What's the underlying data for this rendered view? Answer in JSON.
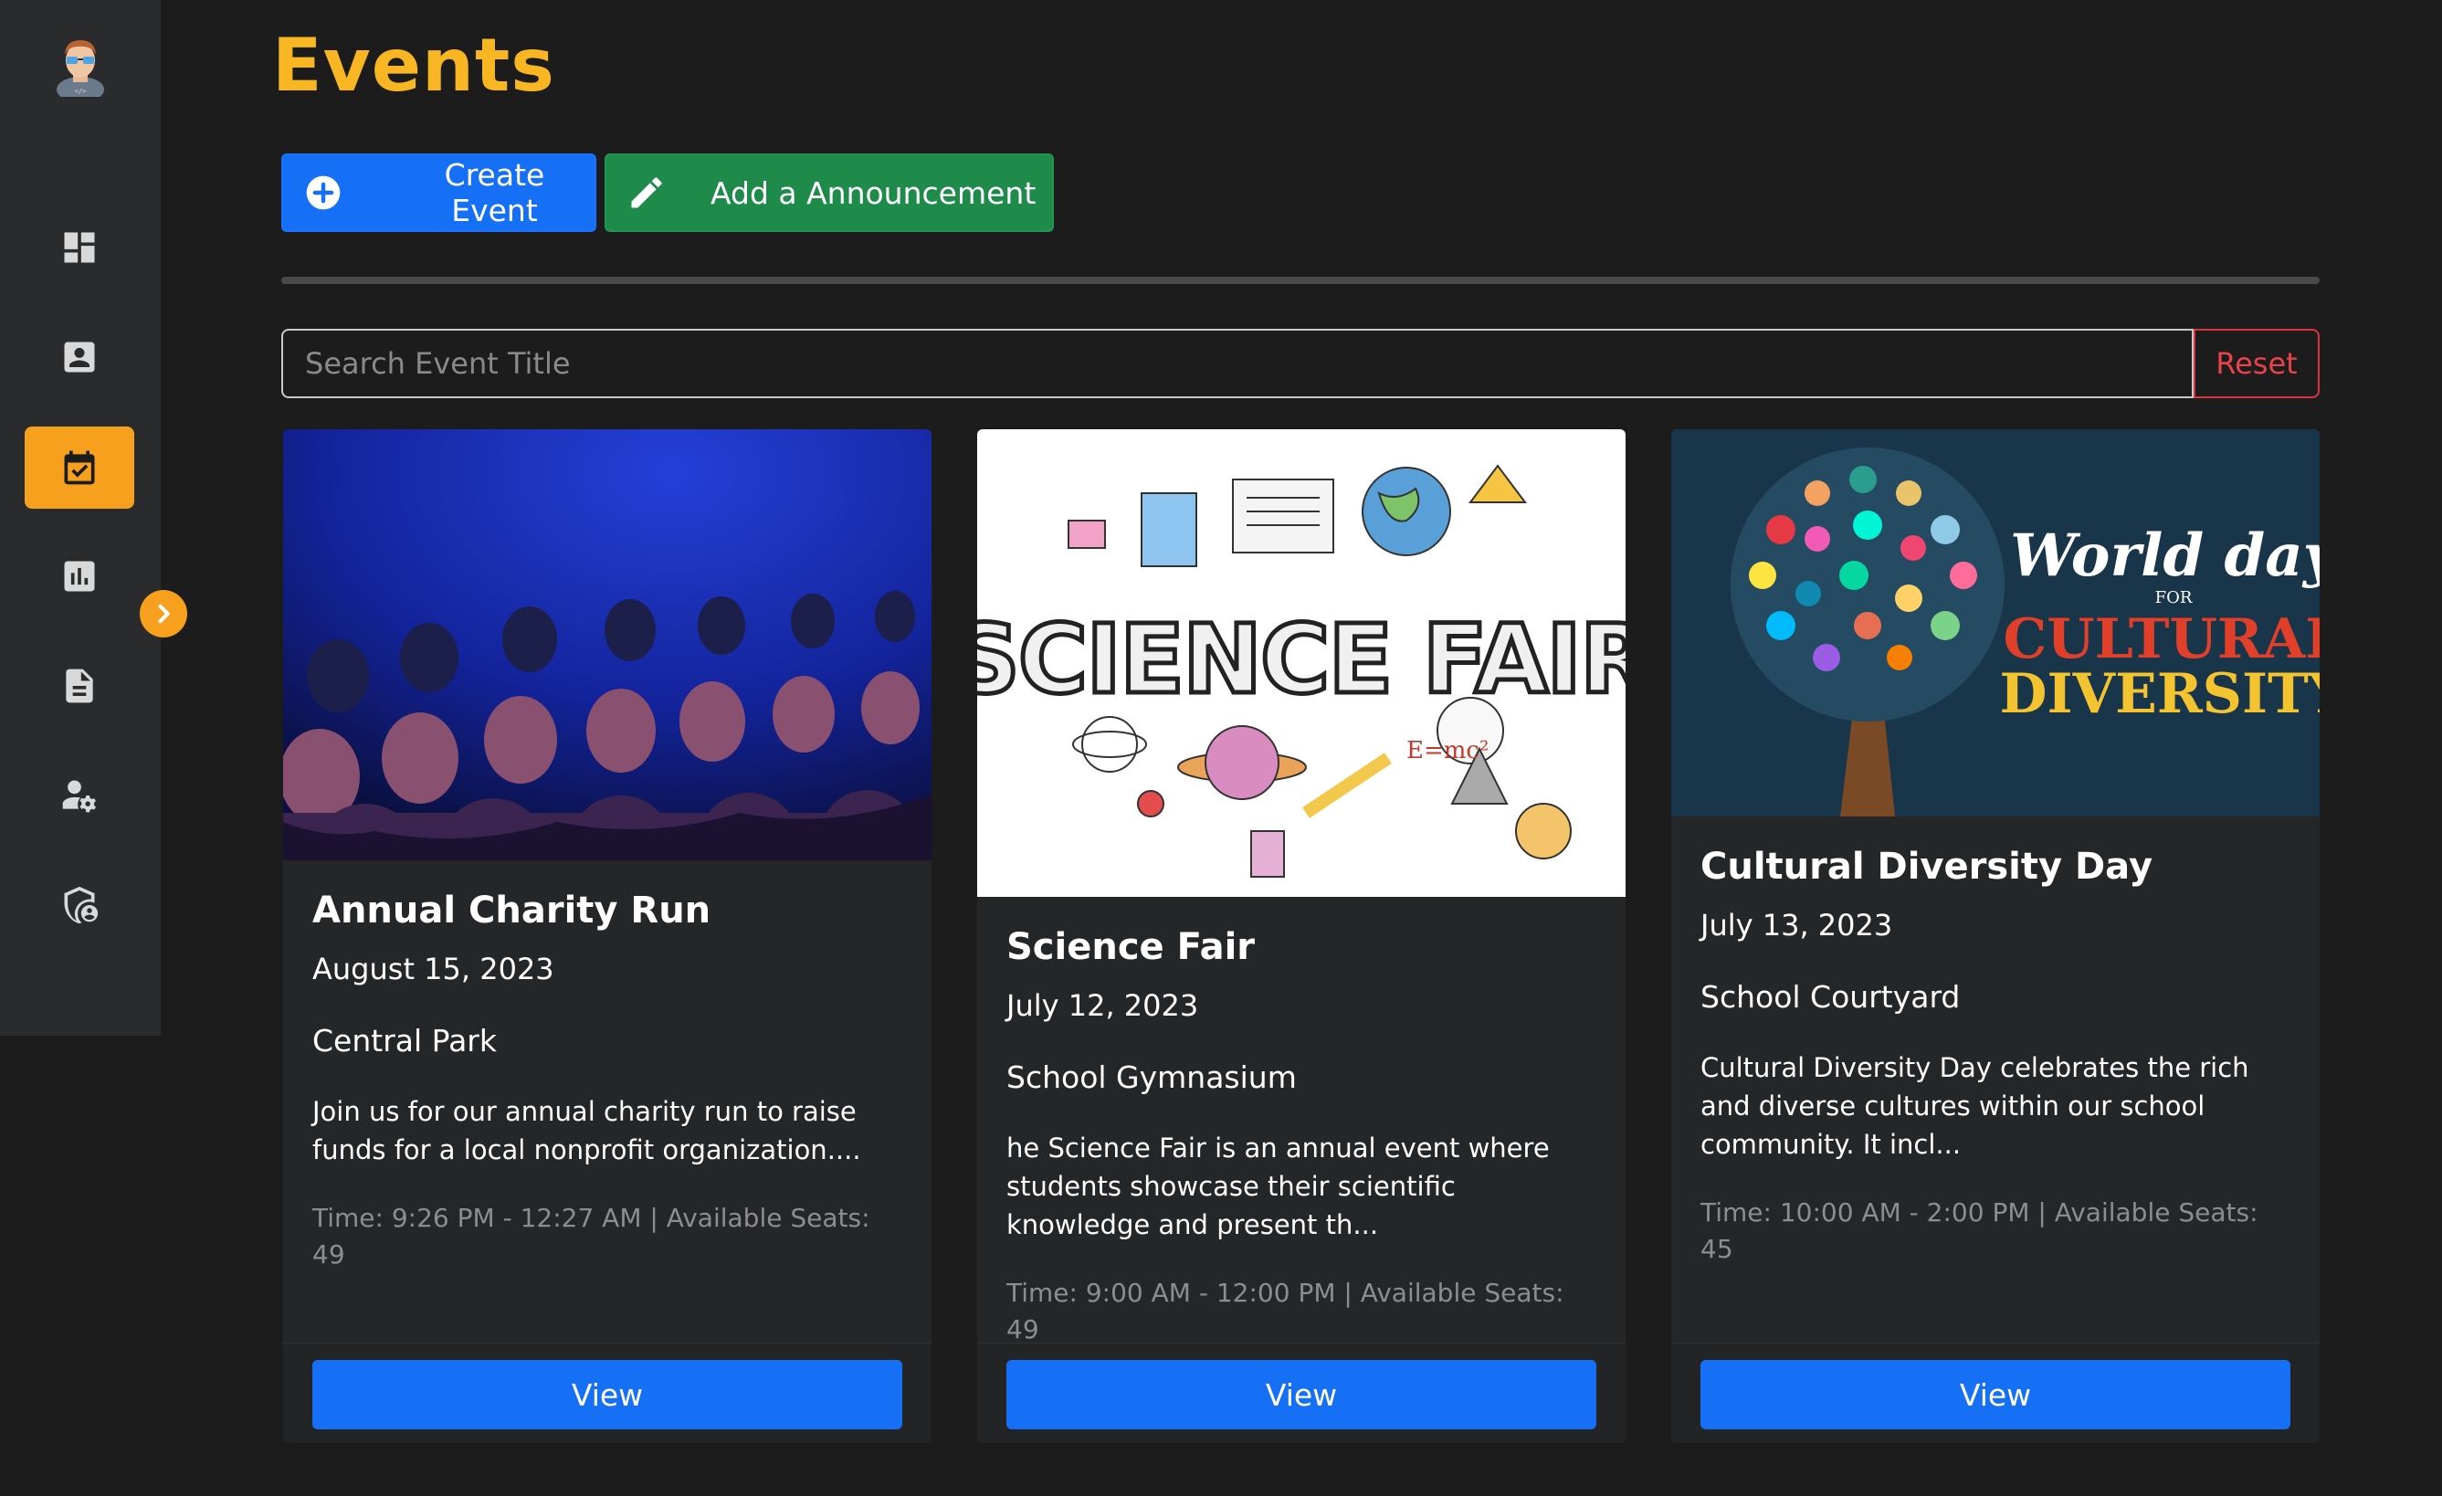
{
  "page": {
    "title": "Events"
  },
  "toolbar": {
    "create_label": "Create Event",
    "announce_label": "Add a Announcement"
  },
  "search": {
    "placeholder": "Search Event Title",
    "value": "",
    "reset_label": "Reset"
  },
  "sidebar": {
    "items": [
      {
        "icon": "dashboard-icon",
        "active": false
      },
      {
        "icon": "profile-card-icon",
        "active": false
      },
      {
        "icon": "calendar-check-icon",
        "active": true
      },
      {
        "icon": "bar-chart-icon",
        "active": false
      },
      {
        "icon": "document-icon",
        "active": false
      },
      {
        "icon": "user-settings-icon",
        "active": false
      },
      {
        "icon": "shield-user-icon",
        "active": false
      }
    ],
    "expand_icon": "chevron-right-icon",
    "accent_color": "#f7a01d"
  },
  "events": [
    {
      "title": "Annual Charity Run",
      "date": "August 15, 2023",
      "venue": "Central Park",
      "description": "Join us for our annual charity run to raise funds for a local nonprofit organization....",
      "meta": "Time: 9:26 PM - 12:27 AM | Available Seats: 49",
      "view_label": "View"
    },
    {
      "title": "Science Fair",
      "date": "July 12, 2023",
      "venue": "School Gymnasium",
      "description": "he Science Fair is an annual event where students showcase their scientific knowledge and present th...",
      "meta": "Time: 9:00 AM - 12:00 PM | Available Seats: 49",
      "view_label": "View",
      "image_text": "SCIENCE FAIR"
    },
    {
      "title": "Cultural Diversity Day",
      "date": "July 13, 2023",
      "venue": "School Courtyard",
      "description": "Cultural Diversity Day celebrates the rich and diverse cultures within our school community. It incl...",
      "meta": "Time: 10:00 AM - 2:00 PM | Available Seats: 45",
      "view_label": "View",
      "image_text": {
        "line1": "World day",
        "line2": "FOR",
        "line3": "CULTURAL",
        "line4": "DIVERSITY"
      }
    }
  ],
  "colors": {
    "title": "#f8b722",
    "primary": "#1670f5",
    "success": "#1f8b4a",
    "danger": "#d7363d",
    "background": "#1c1c1d",
    "card": "#252628"
  }
}
